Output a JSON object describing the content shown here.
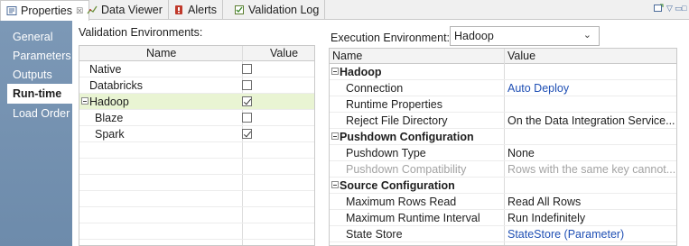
{
  "tabs": [
    {
      "label": "Properties",
      "icon": "properties-icon",
      "close": "☒",
      "active": true
    },
    {
      "label": "Data Viewer",
      "icon": "data-viewer-icon",
      "active": false
    },
    {
      "label": "Alerts",
      "icon": "alerts-icon",
      "active": false
    },
    {
      "label": "Validation Log",
      "icon": "validation-log-icon",
      "active": false
    }
  ],
  "window_controls": {
    "minimize": "▽",
    "restore": "▭",
    "maximize": "□"
  },
  "nav": [
    {
      "label": "General",
      "active": false
    },
    {
      "label": "Parameters",
      "active": false
    },
    {
      "label": "Outputs",
      "active": false
    },
    {
      "label": "Run-time",
      "active": true
    },
    {
      "label": "Load Order",
      "active": false
    }
  ],
  "validation": {
    "label": "Validation Environments:",
    "columns": {
      "name": "Name",
      "value": "Value"
    },
    "rows": [
      {
        "name": "Native",
        "checked": false,
        "indent": 0,
        "expander": false
      },
      {
        "name": "Databricks",
        "checked": false,
        "indent": 0,
        "expander": false
      },
      {
        "name": "Hadoop",
        "checked": true,
        "indent": 0,
        "expander": true,
        "selected": true
      },
      {
        "name": "Blaze",
        "checked": false,
        "indent": 1,
        "expander": false
      },
      {
        "name": "Spark",
        "checked": true,
        "indent": 1,
        "expander": false
      }
    ]
  },
  "execution": {
    "label": "Execution Environment:",
    "selected": "Hadoop",
    "columns": {
      "name": "Name",
      "value": "Value"
    },
    "rows": [
      {
        "type": "category",
        "name": "Hadoop"
      },
      {
        "type": "prop",
        "name": "Connection",
        "value": "Auto Deploy",
        "style": "link"
      },
      {
        "type": "prop",
        "name": "Runtime Properties",
        "value": ""
      },
      {
        "type": "prop",
        "name": "Reject File Directory",
        "value": "On the Data Integration Service..."
      },
      {
        "type": "category",
        "name": "Pushdown Configuration"
      },
      {
        "type": "prop",
        "name": "Pushdown Type",
        "value": "None"
      },
      {
        "type": "prop",
        "name": "Pushdown Compatibility",
        "value": "Rows with the same key cannot...",
        "style": "muted"
      },
      {
        "type": "category",
        "name": "Source Configuration"
      },
      {
        "type": "prop",
        "name": "Maximum Rows Read",
        "value": "Read All Rows"
      },
      {
        "type": "prop",
        "name": "Maximum Runtime Interval",
        "value": "Run Indefinitely"
      },
      {
        "type": "prop",
        "name": "State Store",
        "value": "StateStore (Parameter)",
        "style": "link"
      }
    ]
  },
  "colors": {
    "nav_bg": "#7c98b6",
    "selected_row": "#e9f4d3",
    "link": "#1f4fb4",
    "muted": "#a3a3a3"
  }
}
